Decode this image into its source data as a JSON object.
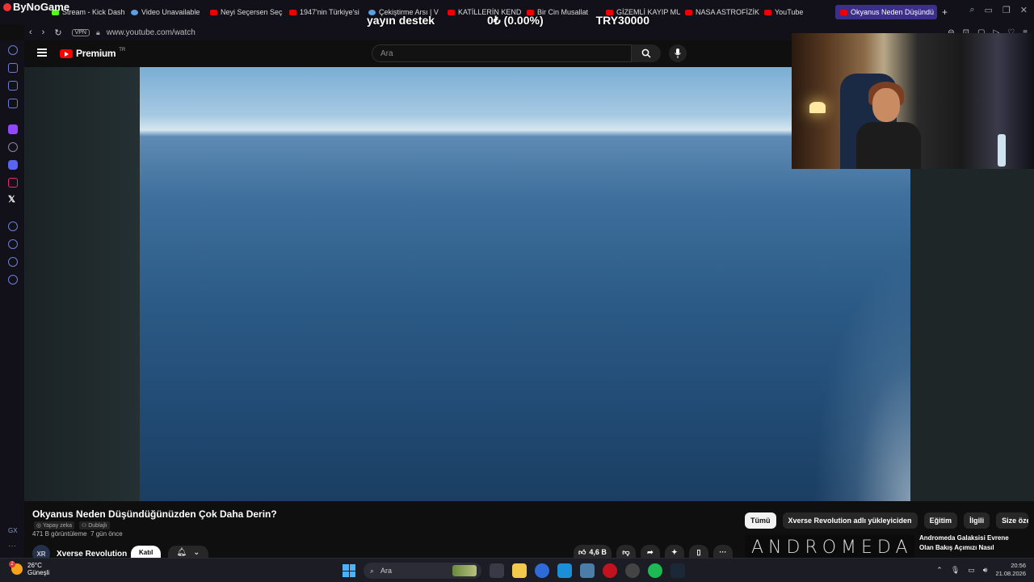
{
  "browser": {
    "brand": "ByNoGame",
    "tabs": [
      {
        "label": "Stream - Kick Dash",
        "icon": "kick-icon"
      },
      {
        "label": "Video Unavailable",
        "icon": "globe-icon"
      },
      {
        "label": "Neyi Seçersen Seç",
        "icon": "youtube-icon"
      },
      {
        "label": "1947'nin Türkiye'si",
        "icon": "youtube-icon"
      },
      {
        "label": "Çekiştirme Arsı | V",
        "icon": "v-icon"
      },
      {
        "label": "KATİLLERİN KENDİ",
        "icon": "youtube-icon"
      },
      {
        "label": "Bir Cin Musallat",
        "icon": "youtube-icon"
      },
      {
        "label": "GİZEMLİ KAYIP MU",
        "icon": "youtube-icon"
      },
      {
        "label": "NASA ASTROFİZİK",
        "icon": "youtube-icon"
      },
      {
        "label": "YouTube",
        "icon": "youtube-icon"
      },
      {
        "label": "Okyanus Neden Düşündü",
        "icon": "youtube-icon",
        "active": true
      }
    ],
    "new_tab": "+",
    "url": "www.youtube.com/watch",
    "vpn": "VPN"
  },
  "overlay": {
    "left": "yayın destek",
    "center": "0₺ (0.00%)",
    "right": "TRY30000"
  },
  "youtube": {
    "logo": "Premium",
    "region": "TR",
    "search_placeholder": "Ara",
    "video": {
      "title": "Okyanus Neden Düşündüğünüzden Çok Daha Derin?",
      "tags": [
        "Yapay zeka",
        "Dublajlı"
      ],
      "views": "471 B görüntüleme",
      "age": "7 gün önce"
    },
    "channel": {
      "name": "Xverse Revolution",
      "avatar": "XR",
      "join": "Katıl"
    },
    "actions": {
      "likes": "4,6 B"
    },
    "chips": [
      "Tümü",
      "Xverse Revolution adlı yükleyiciden",
      "Eğitim",
      "İlgili",
      "Size özel"
    ],
    "recommended": {
      "thumb_text": "ANDROMEDA",
      "title": "Andromeda Galaksisi Evrene Olan Bakış Açımızı Nasıl"
    }
  },
  "taskbar": {
    "weather_temp": "26°C",
    "weather_desc": "Güneşli",
    "weather_badge": "2",
    "search": "Ara",
    "time": "20:56",
    "date": "21.08.2026"
  }
}
